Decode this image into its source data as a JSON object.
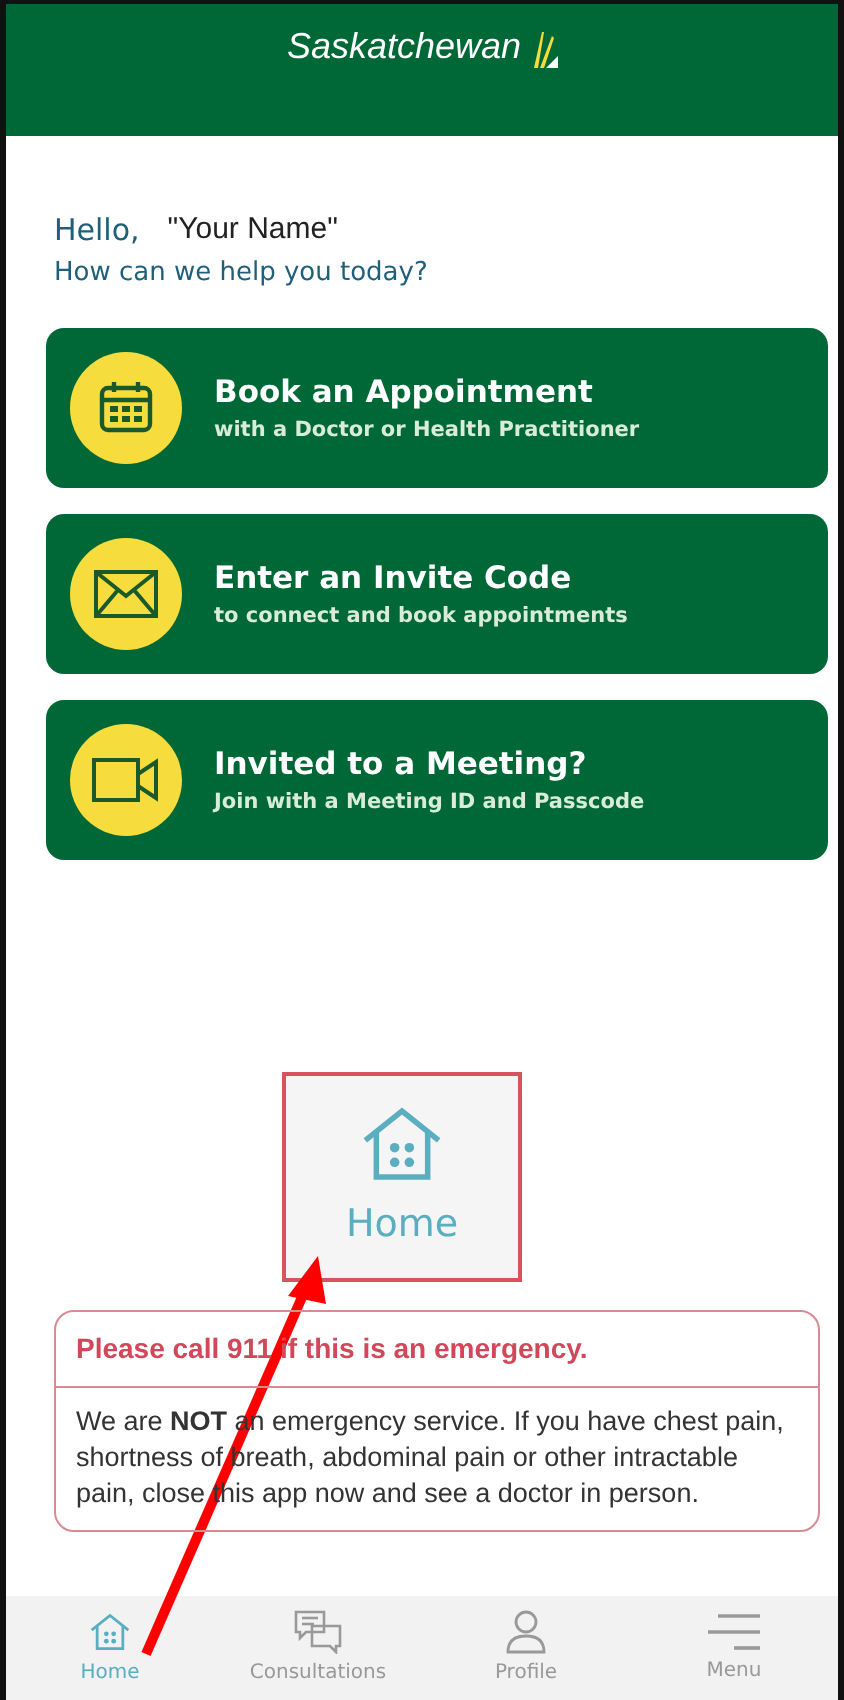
{
  "header": {
    "logo": "Saskatchewan"
  },
  "greeting": {
    "hello": "Hello,",
    "name": "\"Your Name\"",
    "prompt": "How can we help you today?"
  },
  "actions": [
    {
      "kind": "calendar",
      "title": "Book an Appointment",
      "subtitle": "with a Doctor or Health Practitioner"
    },
    {
      "kind": "envelope",
      "title": "Enter an Invite Code",
      "subtitle": "to connect and book appointments"
    },
    {
      "kind": "video",
      "title": "Invited to a Meeting?",
      "subtitle": "Join with a Meeting ID and Passcode"
    }
  ],
  "callout": {
    "label": "Home"
  },
  "notice": {
    "title": "Please call 911 if this is an emergency.",
    "body": "We are **NOT** an emergency service. If you have chest pain, shortness of breath, abdominal pain or other intractable pain, close this app now and see a doctor in person."
  },
  "nav": [
    {
      "kind": "home",
      "label": "Home",
      "selected": true
    },
    {
      "kind": "chat",
      "label": "Consultations",
      "selected": false
    },
    {
      "kind": "profile",
      "label": "Profile",
      "selected": false
    },
    {
      "kind": "menu",
      "label": "Menu",
      "selected": false
    }
  ]
}
